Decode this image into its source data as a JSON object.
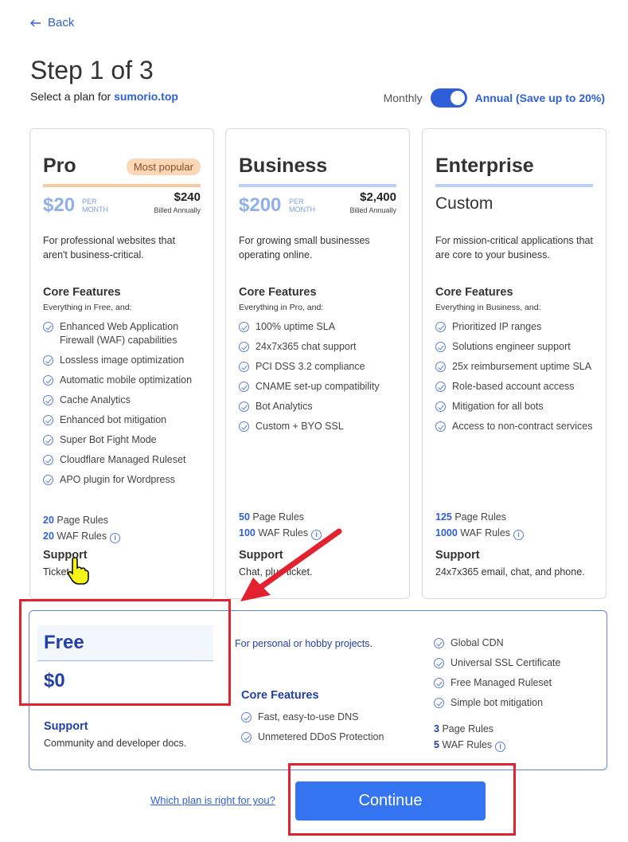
{
  "nav": {
    "back_label": "Back"
  },
  "header": {
    "title": "Step 1 of 3",
    "subtitle_prefix": "Select a plan for ",
    "domain": "sumorio.top"
  },
  "billing": {
    "monthly_label": "Monthly",
    "annual_label": "Annual (Save up to 20%)",
    "annual_selected": true
  },
  "plans": [
    {
      "name": "Pro",
      "badge": "Most popular",
      "price": "$20",
      "per": "PER MONTH",
      "annual_price": "$240",
      "annual_note": "Billed Annually",
      "underline_color": "#f8c99e",
      "description": "For professional websites that aren't business-critical.",
      "core_title": "Core Features",
      "core_sub": "Everything in Free, and:",
      "features": [
        "Enhanced Web Application Firewall (WAF) capabilities",
        "Lossless image optimization",
        "Automatic mobile optimization",
        "Cache Analytics",
        "Enhanced bot mitigation",
        "Super Bot Fight Mode",
        "Cloudflare Managed Ruleset",
        "APO plugin for Wordpress"
      ],
      "page_rules_count": "20",
      "page_rules_label": "Page Rules",
      "waf_rules_count": "20",
      "waf_rules_label": "WAF Rules",
      "support_title": "Support",
      "support_text": "Ticket"
    },
    {
      "name": "Business",
      "price": "$200",
      "per": "PER MONTH",
      "annual_price": "$2,400",
      "annual_note": "Billed Annually",
      "underline_color": "#b9d1f7",
      "description": "For growing small businesses operating online.",
      "core_title": "Core Features",
      "core_sub": "Everything in Pro, and:",
      "features": [
        "100% uptime SLA",
        "24x7x365 chat support",
        "PCI DSS 3.2 compliance",
        "CNAME set-up compatibility",
        "Bot Analytics",
        "Custom + BYO SSL"
      ],
      "page_rules_count": "50",
      "page_rules_label": "Page Rules",
      "waf_rules_count": "100",
      "waf_rules_label": "WAF Rules",
      "support_title": "Support",
      "support_text": "Chat, plus ticket."
    },
    {
      "name": "Enterprise",
      "custom_price": "Custom",
      "underline_color": "#b9d1f7",
      "description": "For mission-critical applications that are core to your business.",
      "core_title": "Core Features",
      "core_sub": "Everything in Business, and:",
      "features": [
        "Prioritized IP ranges",
        "Solutions engineer support",
        "25x reimbursement uptime SLA",
        "Role-based account access",
        "Mitigation for all bots",
        "Access to non-contract services"
      ],
      "page_rules_count": "125",
      "page_rules_label": "Page Rules",
      "waf_rules_count": "1000",
      "waf_rules_label": "WAF Rules",
      "support_title": "Support",
      "support_text": "24x7x365 email, chat, and phone."
    }
  ],
  "free": {
    "name": "Free",
    "price": "$0",
    "description": "For personal or hobby projects.",
    "core_title": "Core Features",
    "features": [
      "Fast, easy-to-use DNS",
      "Unmetered DDoS Protection"
    ],
    "extras": [
      "Global CDN",
      "Universal SSL Certificate",
      "Free Managed Ruleset",
      "Simple bot mitigation"
    ],
    "page_rules_count": "3",
    "page_rules_label": "Page Rules",
    "waf_rules_count": "5",
    "waf_rules_label": "WAF Rules",
    "support_title": "Support",
    "support_text": "Community and developer docs."
  },
  "footer": {
    "help_link": "Which plan is right for you?",
    "continue_label": "Continue"
  },
  "colors": {
    "accent": "#2f5fd8",
    "button": "#3474f0",
    "annotation": "#e2232f"
  }
}
